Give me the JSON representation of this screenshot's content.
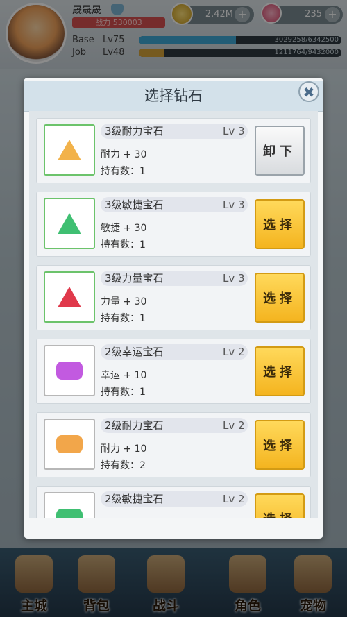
{
  "header": {
    "player_name": "晟晟晟",
    "power_text": "战力 530003",
    "gold": "2.42M",
    "gems": "235",
    "plus_symbol": "+",
    "base_label": "Base",
    "base_level": "Lv75",
    "base_exp_text": "3029258/6342500",
    "base_exp_progress": 0.478,
    "job_label": "Job",
    "job_level": "Lv48",
    "job_exp_text": "1211764/9432000",
    "job_exp_progress": 0.128
  },
  "nav": {
    "items": [
      {
        "label": "主城"
      },
      {
        "label": "背包"
      },
      {
        "label": "战斗"
      },
      {
        "label": "角色"
      },
      {
        "label": "宠物"
      }
    ]
  },
  "modal": {
    "title": "选择钻石",
    "close_symbol": "✖",
    "gems": [
      {
        "name": "3级耐力宝石",
        "level": "Lv 3",
        "stat": "耐力 + 30",
        "owned": "持有数：1",
        "button": "卸下",
        "button_type": "unequip",
        "color": "#f2b24a",
        "shape": "triangle",
        "frame": "green"
      },
      {
        "name": "3级敏捷宝石",
        "level": "Lv 3",
        "stat": "敏捷 + 30",
        "owned": "持有数：1",
        "button": "选择",
        "button_type": "select",
        "color": "#3fbf72",
        "shape": "triangle",
        "frame": "green"
      },
      {
        "name": "3级力量宝石",
        "level": "Lv 3",
        "stat": "力量 + 30",
        "owned": "持有数：1",
        "button": "选择",
        "button_type": "select",
        "color": "#e0394b",
        "shape": "triangle",
        "frame": "green"
      },
      {
        "name": "2级幸运宝石",
        "level": "Lv 2",
        "stat": "幸运 + 10",
        "owned": "持有数：1",
        "button": "选择",
        "button_type": "select",
        "color": "#c25ae0",
        "shape": "hex",
        "frame": "gray"
      },
      {
        "name": "2级耐力宝石",
        "level": "Lv 2",
        "stat": "耐力 + 10",
        "owned": "持有数：2",
        "button": "选择",
        "button_type": "select",
        "color": "#f2a64a",
        "shape": "hex",
        "frame": "gray"
      },
      {
        "name": "2级敏捷宝石",
        "level": "Lv 2",
        "stat": "",
        "owned": "",
        "button": "选择",
        "button_type": "select",
        "color": "#3fbf72",
        "shape": "hex",
        "frame": "gray"
      }
    ]
  }
}
